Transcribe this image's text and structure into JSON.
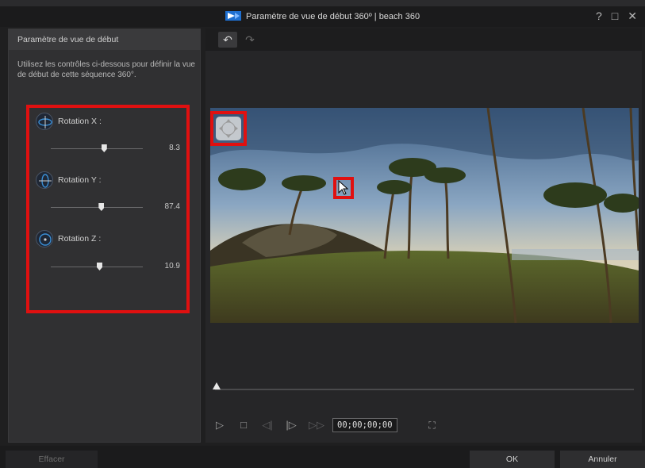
{
  "window": {
    "title": "Paramètre de vue de début 360º  |  beach 360",
    "buttons": {
      "help": "?",
      "maximize": "□",
      "close": "✕"
    }
  },
  "left_panel": {
    "header": "Paramètre de vue de début",
    "description": "Utilisez les contrôles ci-dessous pour définir la vue de début de cette séquence 360°.",
    "controls": [
      {
        "label": "Rotation X :",
        "value": "8.3",
        "level": 0.58,
        "icon": "rotation-x-icon"
      },
      {
        "label": "Rotation Y :",
        "value": "87.4",
        "level": 0.55,
        "icon": "rotation-y-icon"
      },
      {
        "label": "Rotation Z :",
        "value": "10.9",
        "level": 0.53,
        "icon": "rotation-z-icon"
      }
    ]
  },
  "toolbar": {
    "undo": "↶",
    "redo": "↷"
  },
  "player": {
    "timecode": "00;00;00;00",
    "timeline_position": 0,
    "buttons": {
      "play": "▷",
      "stop": "□",
      "prev_frame": "◁|",
      "next_frame": "|▷",
      "fast_forward": "▷▷",
      "fit": "⛶"
    }
  },
  "footer": {
    "clear": "Effacer",
    "ok": "OK",
    "cancel": "Annuler"
  },
  "colors": {
    "highlight": "#e01010",
    "accent": "#3a8fd6"
  }
}
